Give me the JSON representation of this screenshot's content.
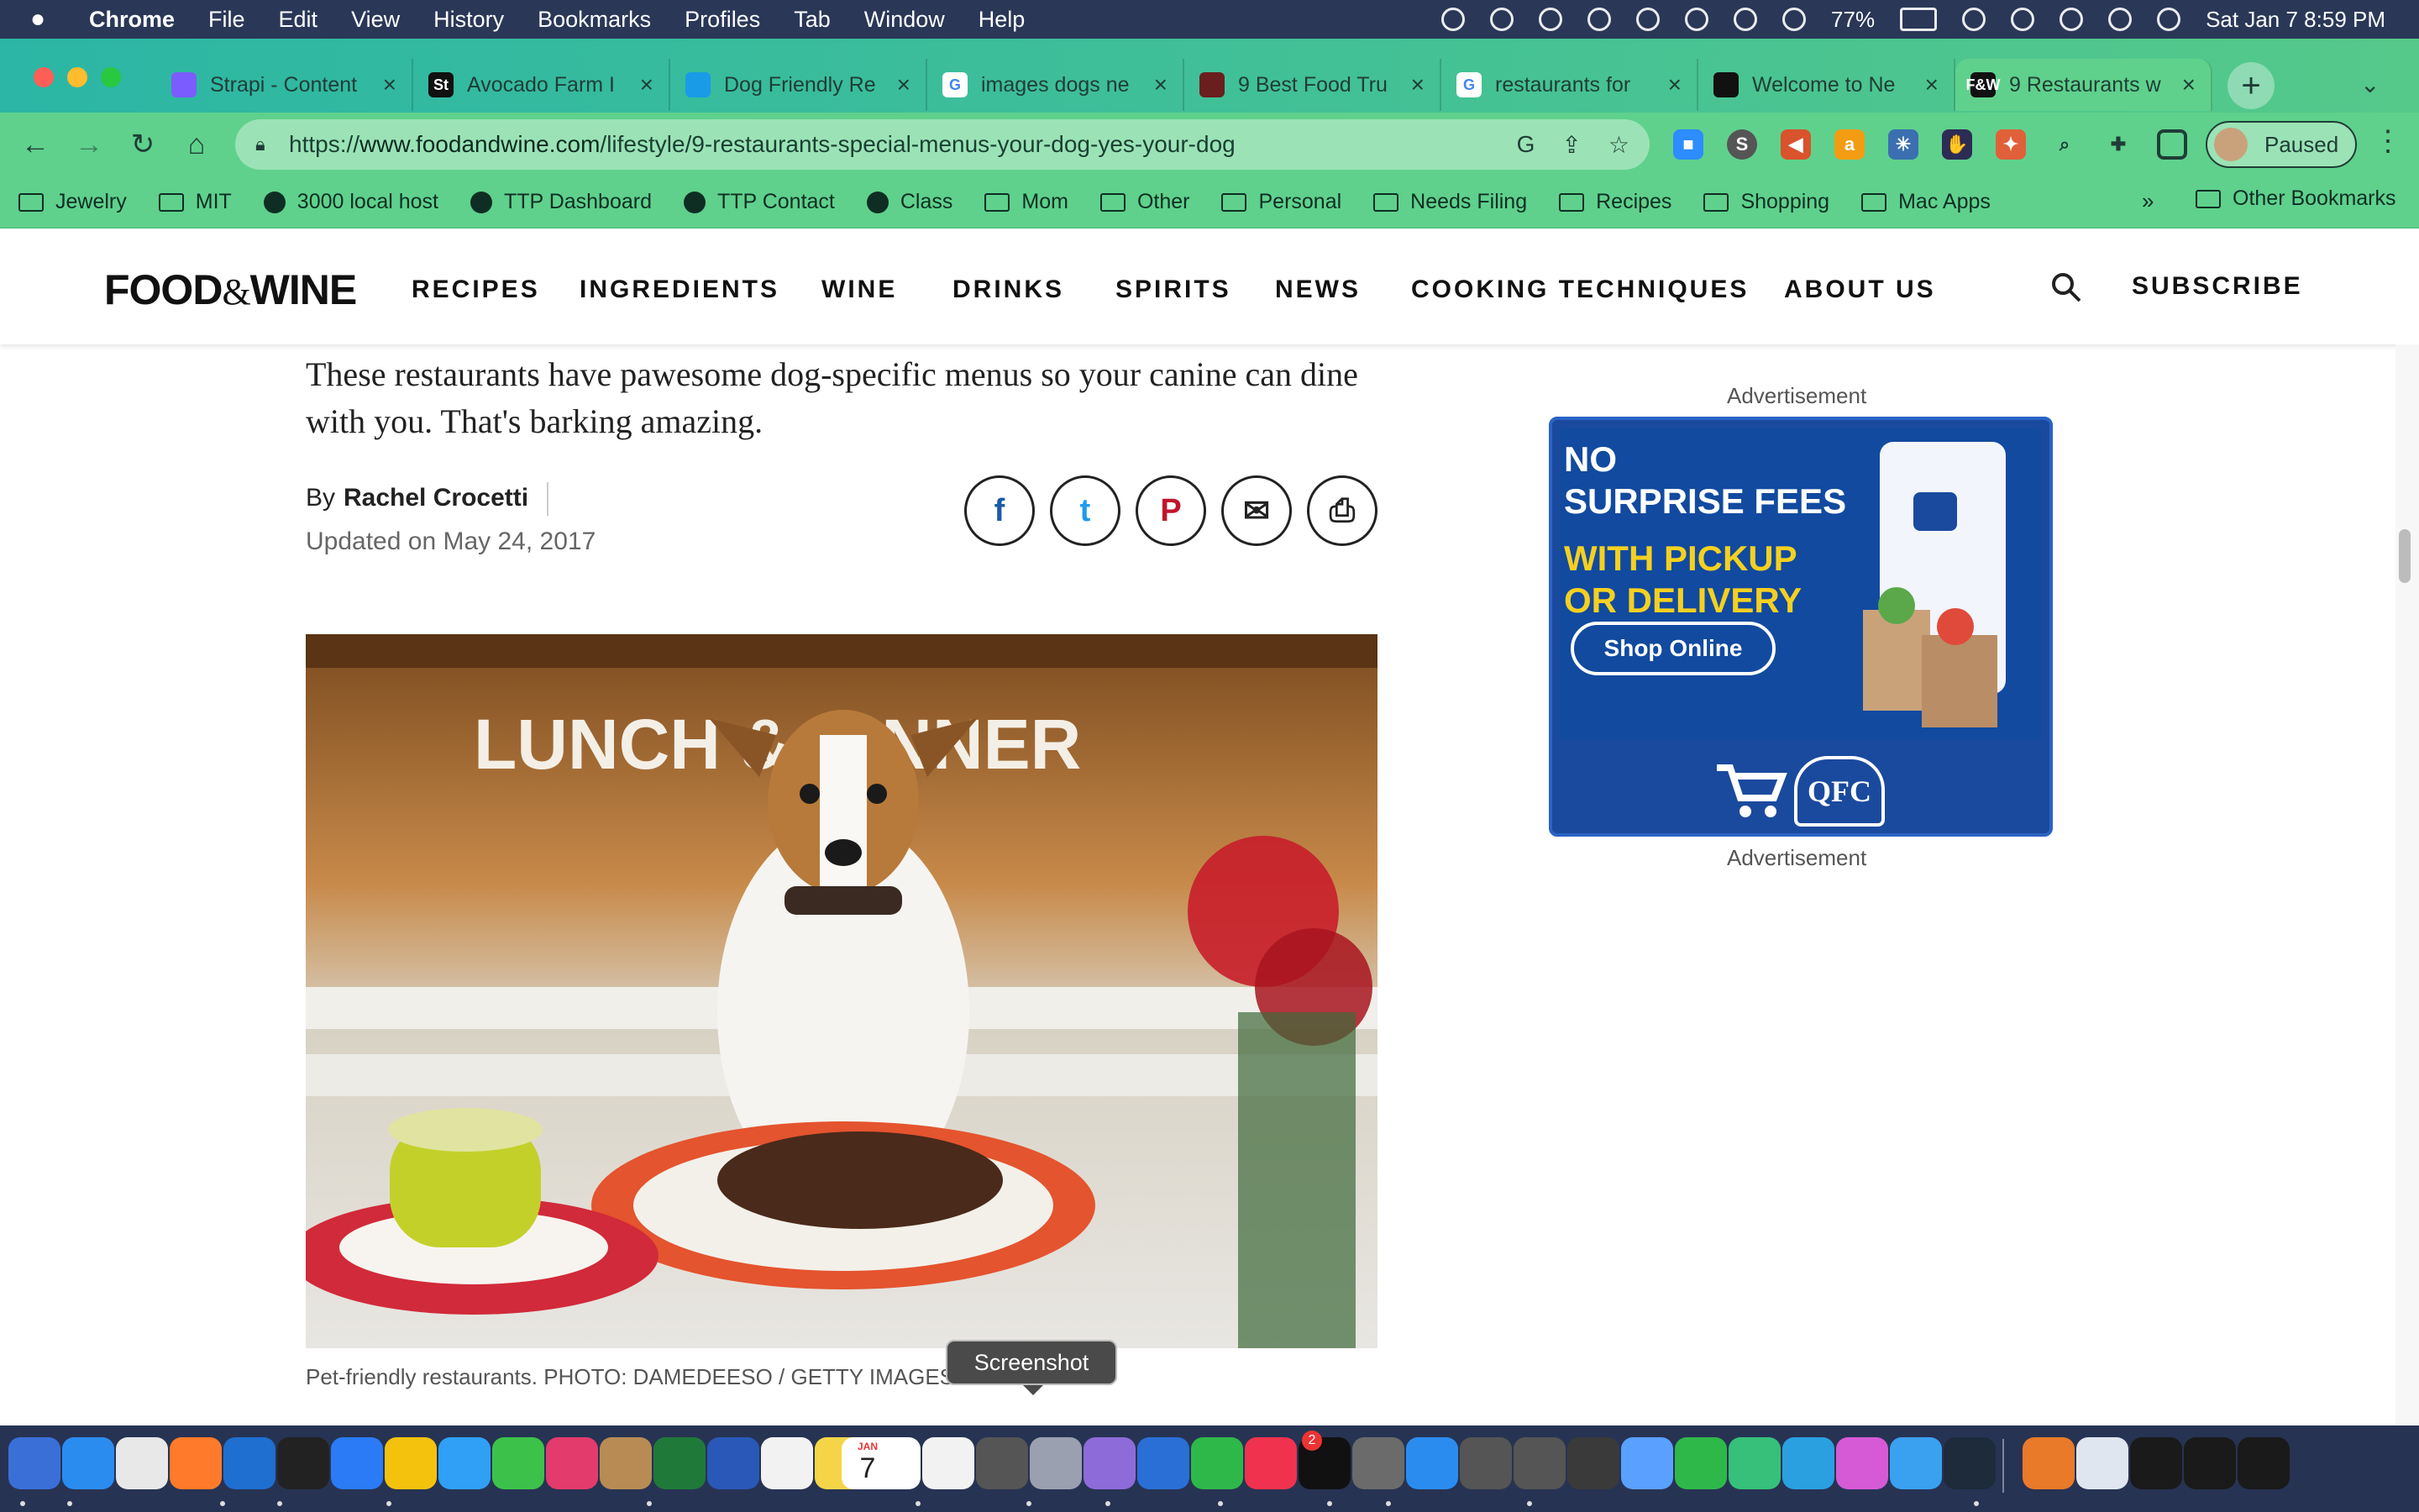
{
  "menubar": {
    "app": "Chrome",
    "items": [
      "File",
      "Edit",
      "View",
      "History",
      "Bookmarks",
      "Profiles",
      "Tab",
      "Window",
      "Help"
    ],
    "battery": "77%",
    "datetime": "Sat Jan 7  8:59 PM"
  },
  "tabs": [
    {
      "title": "Strapi - Content",
      "fav_color": "#7b5cff",
      "fav_text": ""
    },
    {
      "title": "Avocado Farm I",
      "fav_color": "#111111",
      "fav_text": "St"
    },
    {
      "title": "Dog Friendly Re",
      "fav_color": "#1a9be8",
      "fav_text": ""
    },
    {
      "title": "images dogs ne",
      "fav_color": "#ffffff",
      "fav_text": "G"
    },
    {
      "title": "9 Best Food Tru",
      "fav_color": "#6b1e1e",
      "fav_text": ""
    },
    {
      "title": "restaurants for",
      "fav_color": "#ffffff",
      "fav_text": "G"
    },
    {
      "title": "Welcome to Ne",
      "fav_color": "#111111",
      "fav_text": ""
    },
    {
      "title": "9 Restaurants w",
      "fav_color": "#111111",
      "fav_text": "F&W"
    }
  ],
  "omnibox": {
    "scheme": "https://",
    "host": "www.foodandwine.com",
    "path": "/lifestyle/9-restaurants-special-menus-your-dog-yes-your-dog"
  },
  "profile": {
    "label": "Paused"
  },
  "bookmarks": {
    "items": [
      {
        "label": "Jewelry",
        "kind": "folder"
      },
      {
        "label": "MIT",
        "kind": "folder"
      },
      {
        "label": "3000 local host",
        "kind": "globe"
      },
      {
        "label": "TTP Dashboard",
        "kind": "globe"
      },
      {
        "label": "TTP Contact",
        "kind": "globe"
      },
      {
        "label": "Class",
        "kind": "globe"
      },
      {
        "label": "Mom",
        "kind": "folder"
      },
      {
        "label": "Other",
        "kind": "folder"
      },
      {
        "label": "Personal",
        "kind": "folder"
      },
      {
        "label": "Needs Filing",
        "kind": "folder"
      },
      {
        "label": "Recipes",
        "kind": "folder"
      },
      {
        "label": "Shopping",
        "kind": "folder"
      },
      {
        "label": "Mac Apps",
        "kind": "folder"
      }
    ],
    "more": "»",
    "other": "Other Bookmarks"
  },
  "site": {
    "logo_a": "FOOD",
    "logo_amp": "&",
    "logo_b": "WINE",
    "nav": [
      "RECIPES",
      "INGREDIENTS",
      "WINE",
      "DRINKS",
      "SPIRITS",
      "NEWS",
      "COOKING TECHNIQUES",
      "ABOUT US"
    ],
    "subscribe": "SUBSCRIBE"
  },
  "article": {
    "dek": "These restaurants have pawesome dog-specific menus so your canine can dine with you. That's barking amazing.",
    "by": "By",
    "author": "Rachel Crocetti",
    "updated": "Updated on May 24, 2017",
    "share": [
      {
        "name": "facebook-share-button",
        "glyph": "f",
        "color": "#1a5aa6"
      },
      {
        "name": "twitter-share-button",
        "glyph": "t",
        "color": "#1d9bf0"
      },
      {
        "name": "pinterest-share-button",
        "glyph": "P",
        "color": "#c0162c"
      },
      {
        "name": "email-share-button",
        "glyph": "✉",
        "color": "#222222"
      },
      {
        "name": "print-share-button",
        "glyph": "⎙",
        "color": "#222222"
      }
    ],
    "hero_sign": "LUNCH & DINNER",
    "caption": "Pet-friendly restaurants. PHOTO: DAMEDEESO / GETTY IMAGES"
  },
  "ad": {
    "label": "Advertisement",
    "line1a": "NO",
    "line1b": "SURPRISE FEES",
    "line2a": "WITH PICKUP",
    "line2b": "OR DELIVERY",
    "button": "Shop Online",
    "brand": "QFC"
  },
  "tooltip": "Screenshot",
  "dock": {
    "calendar_month": "JAN",
    "calendar_day": "7",
    "facetime_badge": "2",
    "colors": [
      "#3a6fd8",
      "#2b8cf0",
      "#e8e8e8",
      "#ff7a2a",
      "#1e6fd0",
      "#222",
      "#2a7bf5",
      "#f4c20d",
      "#2fa0f5",
      "#3cc24a",
      "#e33b6c",
      "#b98b54",
      "#1f7a3a",
      "#2a58b8",
      "#f2f2f2",
      "#f5d547",
      "#ffffff",
      "#f2f2f2",
      "#555",
      "#9aa0b0",
      "#8d6bd8",
      "#2a6fd6",
      "#2fb84a",
      "#f0324e",
      "#111",
      "#6b6b6b",
      "#2b8cf0",
      "#555",
      "#555",
      "#3a3a3a",
      "#5aa0ff",
      "#2fb84a",
      "#36c07a",
      "#2aa0e0",
      "#d65ad6",
      "#3aa0f0",
      "#1d2b3a",
      "#e87a2a",
      "#dfe6f0",
      "#1a1a1a",
      "#1a1a1a",
      "#1a1a1a"
    ]
  }
}
